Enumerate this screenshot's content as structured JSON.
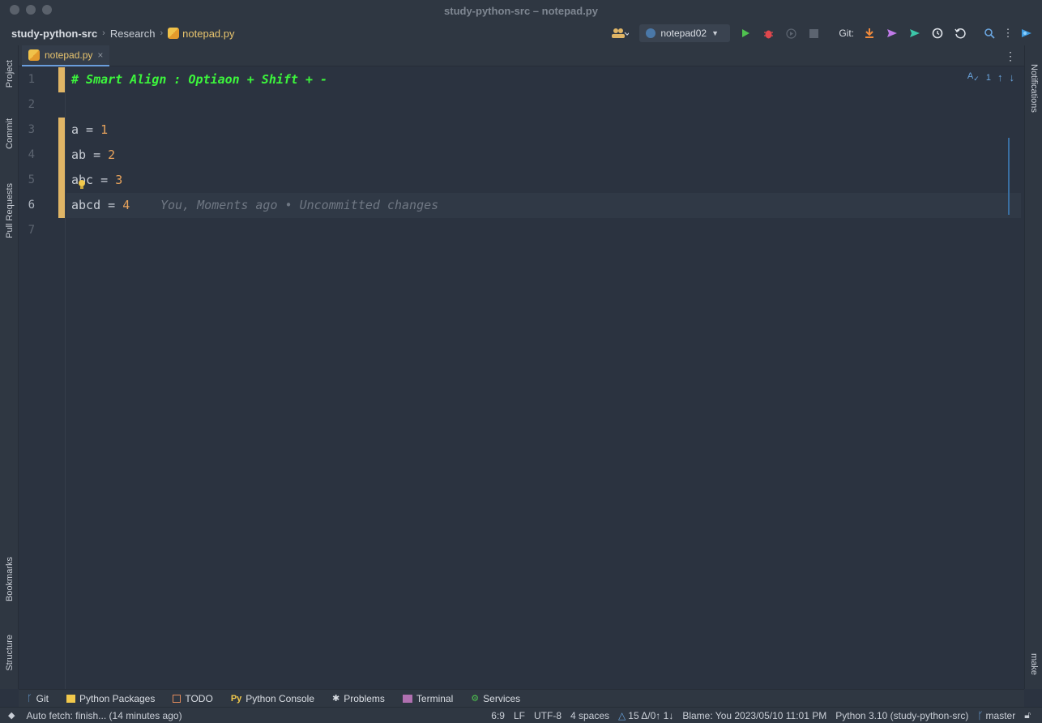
{
  "window": {
    "title": "study-python-src – notepad.py"
  },
  "breadcrumb": {
    "project": "study-python-src",
    "folder": "Research",
    "file": "notepad.py"
  },
  "toolbar": {
    "run_config": "notepad02",
    "git_label": "Git:",
    "icons": [
      "users-icon",
      "python-icon",
      "run-icon",
      "debug-icon",
      "coverage-icon",
      "stop-icon",
      "git-update-icon",
      "git-push-icon",
      "git-commit-icon",
      "history-icon",
      "rollback-icon",
      "search-icon",
      "more-icon",
      "jetbrains-ai-icon"
    ]
  },
  "left_tools": {
    "project": "Project",
    "commit": "Commit",
    "pull_requests": "Pull Requests",
    "bookmarks": "Bookmarks",
    "structure": "Structure"
  },
  "right_tools": {
    "notifications": "Notifications",
    "make": "make"
  },
  "tab": {
    "label": "notepad.py",
    "close": "×"
  },
  "inspection": {
    "count": "1"
  },
  "lines": [
    {
      "num": "1",
      "text": "# Smart Align : Optiaon + Shift + -"
    },
    {
      "num": "2",
      "text": ""
    },
    {
      "num": "3",
      "name": "a",
      "op": " = ",
      "value": "1"
    },
    {
      "num": "4",
      "name": "ab",
      "op": " = ",
      "value": "2"
    },
    {
      "num": "5",
      "name": "abc",
      "op": " = ",
      "value": "3"
    },
    {
      "num": "6",
      "name": "abcd",
      "op": " = ",
      "value": "4",
      "blame": "You, Moments ago • Uncommitted changes"
    },
    {
      "num": "7",
      "text": ""
    }
  ],
  "tool_windows": {
    "git": "Git",
    "python_packages": "Python Packages",
    "todo": "TODO",
    "python_console": "Python Console",
    "problems": "Problems",
    "terminal": "Terminal",
    "services": "Services"
  },
  "status": {
    "message": "Auto fetch: finish... (14 minutes ago)",
    "position": "6:9",
    "line_ending": "LF",
    "encoding": "UTF-8",
    "indent": "4 spaces",
    "git_changes": "15 Δ/0↑ 1↓",
    "blame": "Blame: You 2023/05/10 11:01 PM",
    "interpreter": "Python 3.10 (study-python-src)",
    "branch": "master"
  },
  "colors": {
    "comment": "#3cf53c",
    "number": "#e8a35c",
    "marker": "#e0b566",
    "background": "#2b3340"
  }
}
